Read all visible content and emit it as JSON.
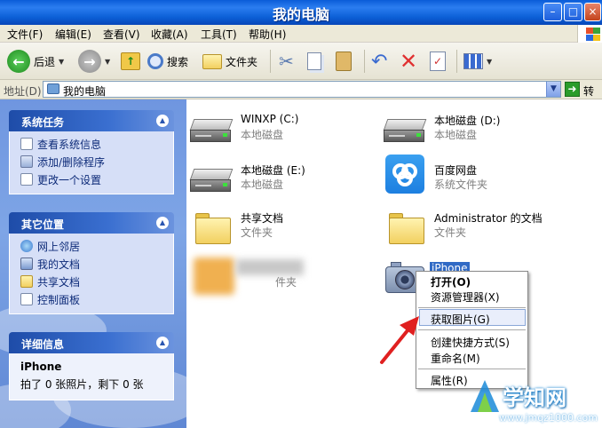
{
  "window": {
    "title": "我的电脑"
  },
  "menu": [
    "文件(F)",
    "编辑(E)",
    "查看(V)",
    "收藏(A)",
    "工具(T)",
    "帮助(H)"
  ],
  "toolbar": {
    "back": "后退",
    "search": "搜索",
    "folders": "文件夹"
  },
  "address": {
    "label": "地址(D)",
    "value": "我的电脑",
    "go": "转到"
  },
  "panels": {
    "tasks": {
      "title": "系统任务",
      "items": [
        "查看系统信息",
        "添加/删除程序",
        "更改一个设置"
      ]
    },
    "places": {
      "title": "其它位置",
      "items": [
        "网上邻居",
        "我的文档",
        "共享文档",
        "控制面板"
      ]
    },
    "details": {
      "title": "详细信息",
      "name": "iPhone",
      "info": "拍了 0 张照片，剩下 0 张"
    }
  },
  "items": [
    {
      "name": "WINXP (C:)",
      "sub": "本地磁盘",
      "icon": "hard-drive-icon"
    },
    {
      "name": "本地磁盘 (D:)",
      "sub": "本地磁盘",
      "icon": "hard-drive-icon"
    },
    {
      "name": "本地磁盘 (E:)",
      "sub": "本地磁盘",
      "icon": "hard-drive-icon"
    },
    {
      "name": "百度网盘",
      "sub": "系统文件夹",
      "icon": "baidu-netdisk-icon"
    },
    {
      "name": "共享文档",
      "sub": "文件夹",
      "icon": "folder-icon"
    },
    {
      "name": "Administrator 的文档",
      "sub": "文件夹",
      "icon": "folder-icon"
    },
    {
      "name": "",
      "sub": "件夹",
      "icon": "folder-icon"
    },
    {
      "name": "iPhone",
      "sub": "",
      "icon": "camera-icon"
    }
  ],
  "context_menu": [
    "打开(O)",
    "资源管理器(X)",
    "获取图片(G)",
    "创建快捷方式(S)",
    "重命名(M)",
    "属性(R)"
  ],
  "watermark": {
    "text": "学知网",
    "url": "www.jmqz1000.com"
  }
}
